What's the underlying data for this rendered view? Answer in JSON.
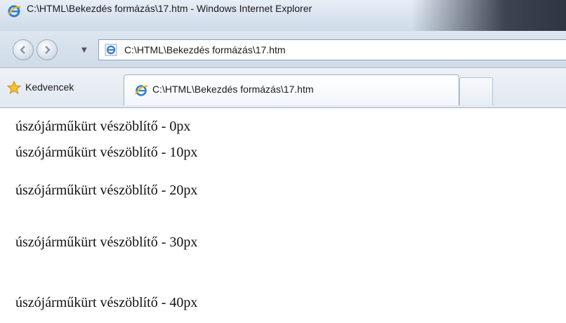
{
  "window": {
    "title": "C:\\HTML\\Bekezdés formázás\\17.htm - Windows Internet Explorer"
  },
  "navigation": {
    "back_icon": "back-arrow-icon",
    "forward_icon": "forward-arrow-icon",
    "address": "C:\\HTML\\Bekezdés formázás\\17.htm"
  },
  "favorites": {
    "label": "Kedvencek",
    "icon": "star-icon"
  },
  "tabs": [
    {
      "label": "C:\\HTML\\Bekezdés formázás\\17.htm"
    }
  ],
  "content": {
    "lines": [
      "úszójárműkürt vészöblítő - 0px",
      "úszójárműkürt vészöblítő - 10px",
      "úszójárműkürt vészöblítő - 20px",
      "úszójárműkürt vészöblítő - 30px",
      "úszójárműkürt vészöblítő - 40px"
    ]
  }
}
